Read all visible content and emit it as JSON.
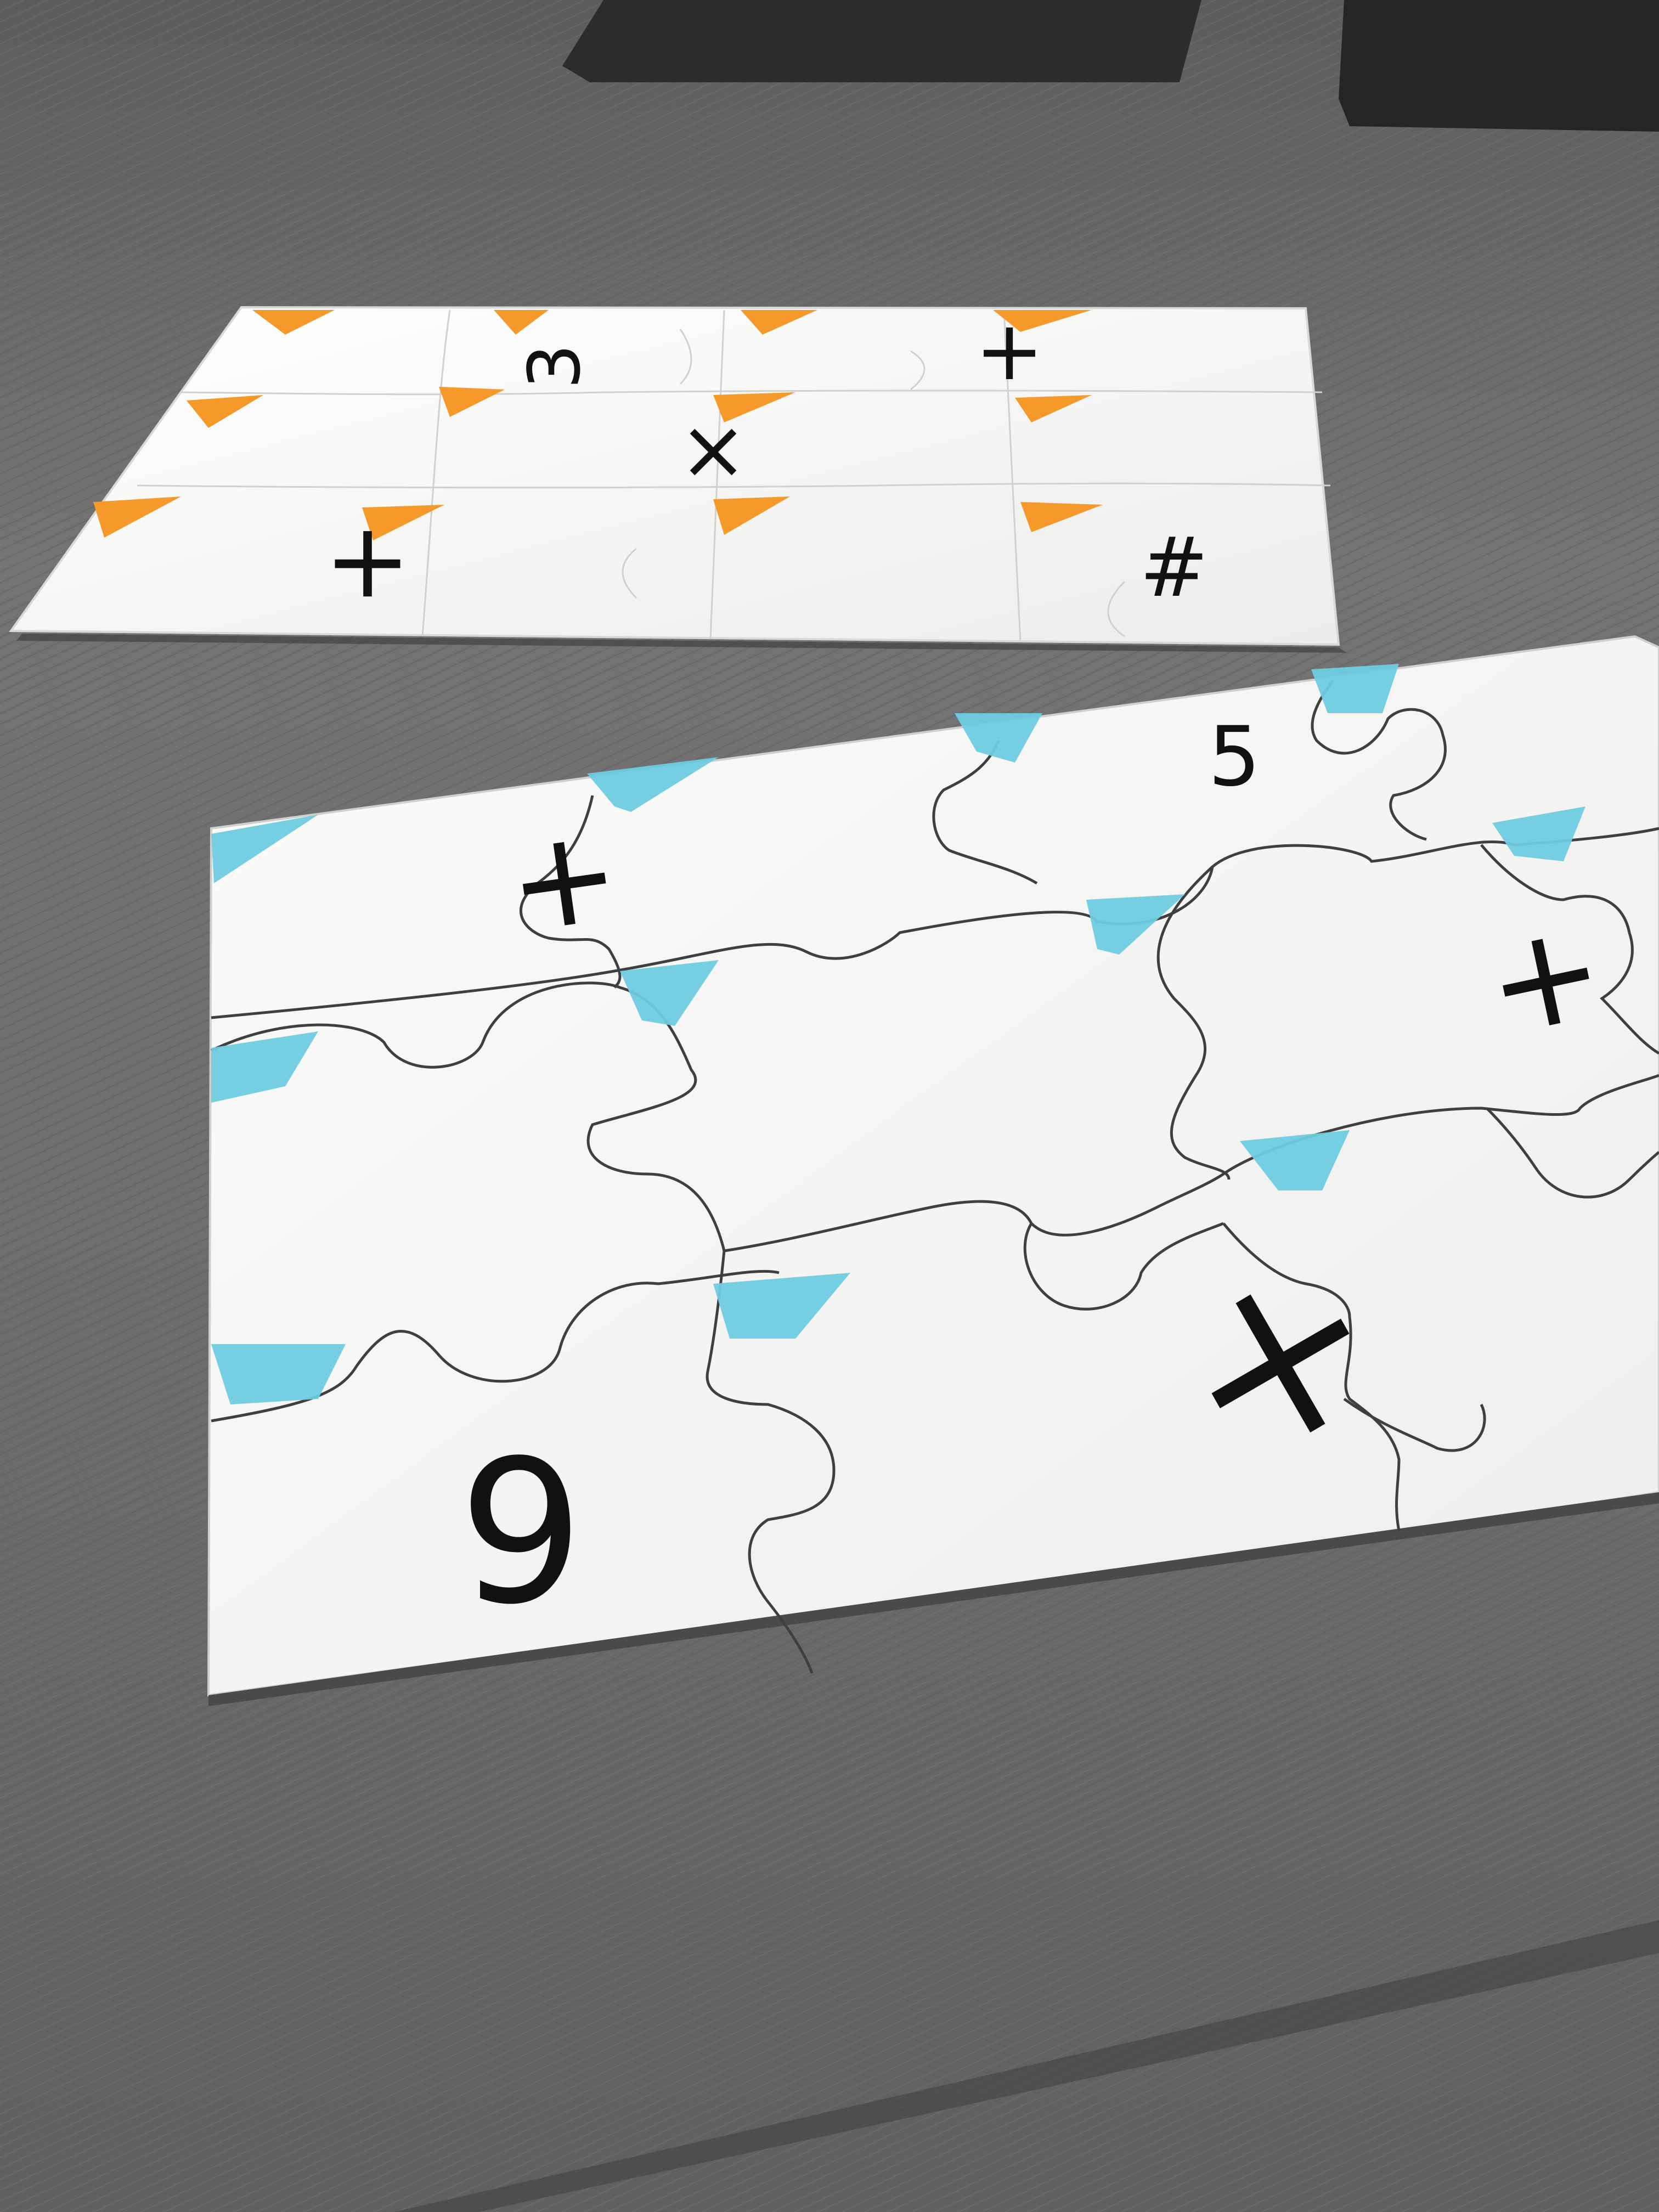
{
  "scene": {
    "colors": {
      "table": "#6f6f70",
      "card": "#f7f7f5",
      "orange_marks": "#f59a2a",
      "blue_marks": "#6fcbe0",
      "ink": "#111111"
    },
    "back_puzzle": {
      "symbols": [
        "3",
        "+",
        "×",
        "+",
        "#"
      ]
    },
    "front_puzzle": {
      "symbols": [
        "5",
        "+",
        "+",
        "×",
        "9"
      ]
    }
  }
}
